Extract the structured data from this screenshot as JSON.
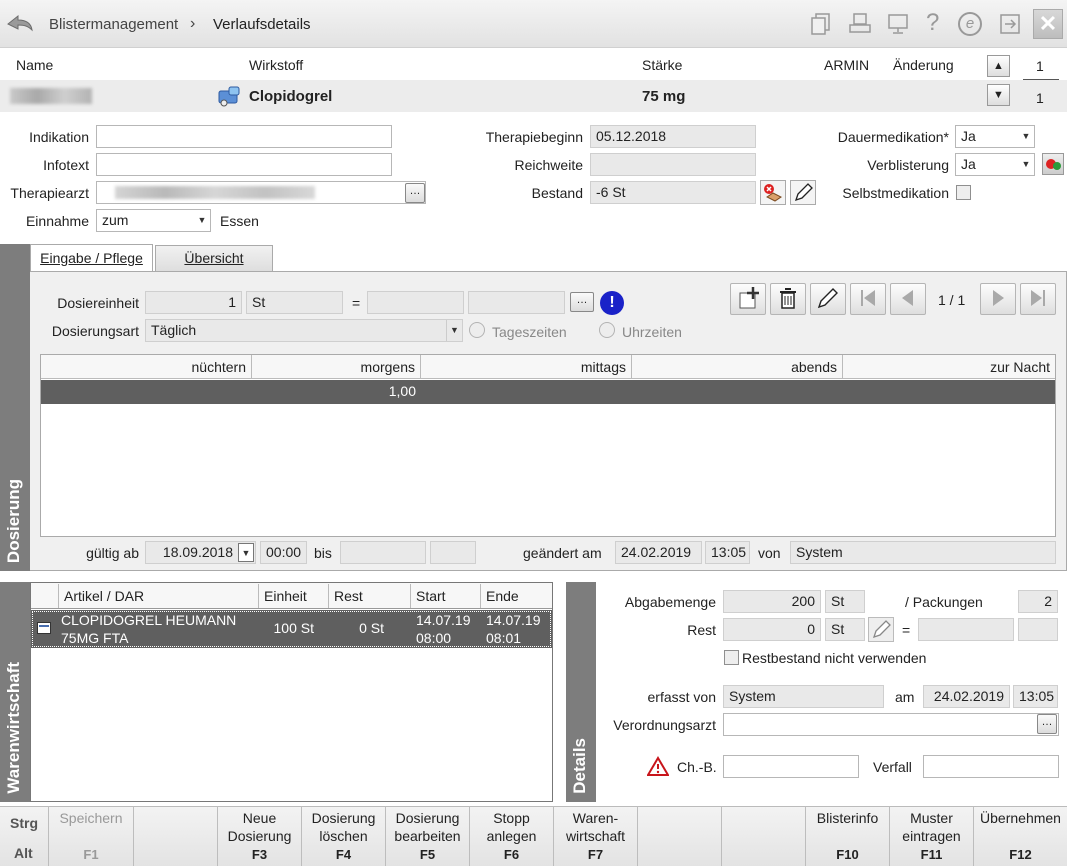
{
  "breadcrumb": {
    "root": "Blistermanagement",
    "sep": "›",
    "current": "Verlaufsdetails"
  },
  "header": {
    "col_name": "Name",
    "col_wirkstoff": "Wirkstoff",
    "col_staerke": "Stärke",
    "armin": "ARMIN",
    "aenderung": "Änderung",
    "wirkstoff": "Clopidogrel",
    "staerke": "75 mg",
    "counter_top": "1",
    "counter_bottom": "1"
  },
  "form": {
    "indikation_label": "Indikation",
    "indikation_value": "",
    "infotext_label": "Infotext",
    "infotext_value": "",
    "therapiearzt_label": "Therapiearzt",
    "einnahme_label": "Einnahme",
    "einnahme_value": "zum",
    "essen_label": "Essen",
    "therapiebeginn_label": "Therapiebeginn",
    "therapiebeginn_value": "05.12.2018",
    "reichweite_label": "Reichweite",
    "reichweite_value": "",
    "bestand_label": "Bestand",
    "bestand_value": "-6 St",
    "dauermed_label": "Dauermedikation*",
    "dauermed_value": "Ja",
    "verblisterung_label": "Verblisterung",
    "verblisterung_value": "Ja",
    "selbstmed_label": "Selbstmedikation"
  },
  "dosierung": {
    "section_label": "Dosierung",
    "tab_eingabe": "Eingabe / Pflege",
    "tab_uebersicht": "Übersicht",
    "dosiereinheit_label": "Dosiereinheit",
    "dosiereinheit_value": "1",
    "dosiereinheit_unit": "St",
    "equals": "=",
    "dosierungsart_label": "Dosierungsart",
    "dosierungsart_value": "Täglich",
    "tageszeiten_label": "Tageszeiten",
    "uhrzeiten_label": "Uhrzeiten",
    "page_indicator": "1 / 1",
    "columns": [
      "nüchtern",
      "morgens",
      "mittags",
      "abends",
      "zur Nacht"
    ],
    "row": [
      "",
      "1,00",
      "",
      "",
      ""
    ],
    "gueltig_ab_label": "gültig ab",
    "gueltig_ab_value": "18.09.2018",
    "gueltig_ab_time": "00:00",
    "bis_label": "bis",
    "geaendert_label": "geändert am",
    "geaendert_date": "24.02.2019",
    "geaendert_time": "13:05",
    "von_label": "von",
    "von_value": "System"
  },
  "warenwirtschaft": {
    "section_label": "Warenwirtschaft",
    "columns": [
      "Artikel / DAR",
      "Einheit",
      "Rest",
      "Start",
      "Ende"
    ],
    "rows": [
      {
        "artikel": "CLOPIDOGREL HEUMANN 75MG FTA",
        "einheit": "100 St",
        "rest": "0 St",
        "start": "14.07.19 08:00",
        "ende": "14.07.19 08:01"
      }
    ]
  },
  "details": {
    "section_label": "Details",
    "abgabemenge_label": "Abgabemenge",
    "abgabemenge_value": "200",
    "abgabemenge_unit": "St",
    "packungen_label": "/ Packungen",
    "packungen_value": "2",
    "rest_label": "Rest",
    "rest_value": "0",
    "rest_unit": "St",
    "equals": "=",
    "restbestand_label": "Restbestand nicht verwenden",
    "erfasst_label": "erfasst von",
    "erfasst_value": "System",
    "am_label": "am",
    "am_date": "24.02.2019",
    "am_time": "13:05",
    "verordnungsarzt_label": "Verordnungsarzt",
    "chb_label": "Ch.-B.",
    "verfall_label": "Verfall"
  },
  "fkeys": {
    "strg": "Strg",
    "alt": "Alt",
    "f1_text": "Speichern",
    "f1_key": "F1",
    "f3_text": "Neue Dosierung",
    "f3_key": "F3",
    "f4_text": "Dosierung löschen",
    "f4_key": "F4",
    "f5_text": "Dosierung bearbeiten",
    "f5_key": "F5",
    "f6_text": "Stopp anlegen",
    "f6_key": "F6",
    "f7_text": "Waren-wirtschaft",
    "f7_key": "F7",
    "f10_text": "Blisterinfo",
    "f10_key": "F10",
    "f11_text": "Muster eintragen",
    "f11_key": "F11",
    "f12_text": "Übernehmen",
    "f12_key": "F12"
  },
  "colors": {
    "accent": "#7d7d7d",
    "selected_row": "#5f5f5f",
    "info_blue": "#1a22c8",
    "warn_red": "#c8151b"
  }
}
